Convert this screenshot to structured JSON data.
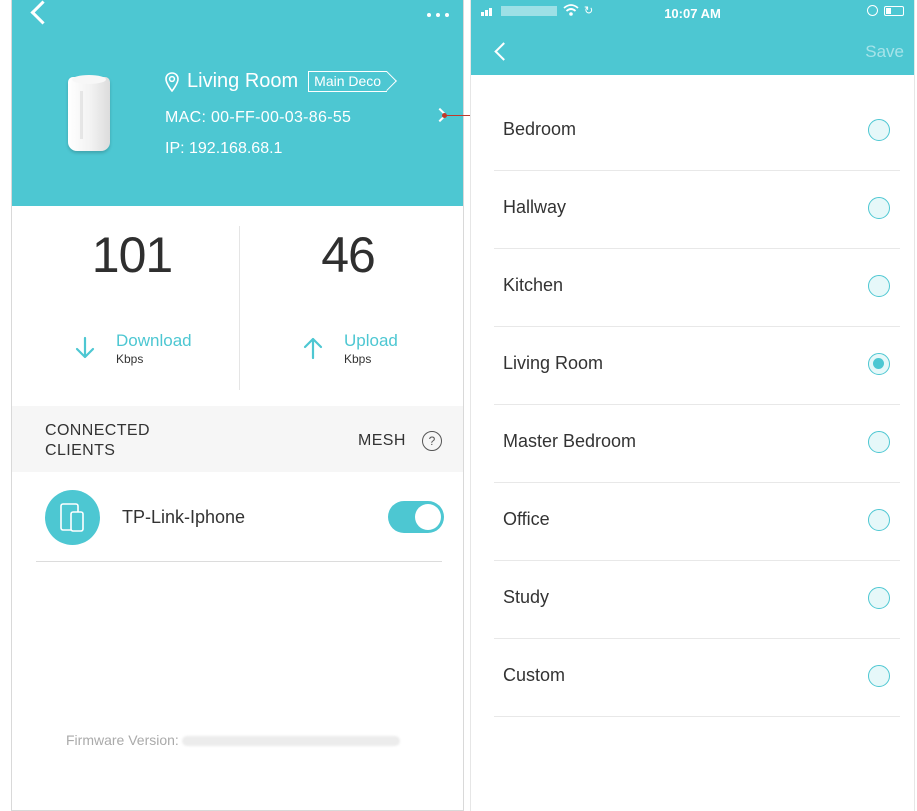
{
  "colors": {
    "accent": "#4dc7d2",
    "connector": "#c0392b"
  },
  "device_screen": {
    "header": {
      "location_name": "Living Room",
      "role_tag": "Main Deco",
      "mac_text": "MAC: 00-FF-00-03-86-55",
      "ip_text": "IP: 192.168.68.1"
    },
    "stats": {
      "download": {
        "value": "101",
        "label": "Download",
        "unit": "Kbps"
      },
      "upload": {
        "value": "46",
        "label": "Upload",
        "unit": "Kbps"
      }
    },
    "clients_section": {
      "title": "CONNECTED CLIENTS",
      "mesh_label": "MESH",
      "help_symbol": "?"
    },
    "clients": [
      {
        "name": "TP-Link-Iphone",
        "mesh_enabled": true
      }
    ],
    "firmware_label": "Firmware Version:"
  },
  "location_screen": {
    "status_bar": {
      "time": "10:07 AM"
    },
    "nav": {
      "save_label": "Save"
    },
    "selected": "Living Room",
    "options": [
      {
        "label": "Bedroom",
        "selected": false
      },
      {
        "label": "Hallway",
        "selected": false
      },
      {
        "label": "Kitchen",
        "selected": false
      },
      {
        "label": "Living Room",
        "selected": true
      },
      {
        "label": "Master Bedroom",
        "selected": false
      },
      {
        "label": "Office",
        "selected": false
      },
      {
        "label": "Study",
        "selected": false
      },
      {
        "label": "Custom",
        "selected": false
      }
    ]
  }
}
